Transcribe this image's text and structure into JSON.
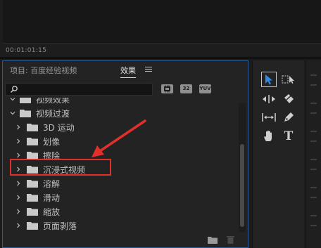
{
  "program_monitor": {
    "timecode": "00:01:01:15"
  },
  "project_panel": {
    "tab_project": "项目: 百度经验视频",
    "tab_effects": "效果",
    "search": {
      "value": "",
      "placeholder": ""
    },
    "filter_buttons": {
      "accelerated": "",
      "bit32": "32",
      "yuv": "YUV"
    },
    "tree": [
      {
        "label": "视频效果",
        "indent": 0,
        "expanded": true,
        "highlighted": false
      },
      {
        "label": "视频过渡",
        "indent": 0,
        "expanded": true,
        "highlighted": false
      },
      {
        "label": "3D 运动",
        "indent": 1,
        "expanded": false,
        "highlighted": false
      },
      {
        "label": "划像",
        "indent": 1,
        "expanded": false,
        "highlighted": false
      },
      {
        "label": "擦除",
        "indent": 1,
        "expanded": false,
        "highlighted": false
      },
      {
        "label": "沉浸式视频",
        "indent": 1,
        "expanded": false,
        "highlighted": true
      },
      {
        "label": "溶解",
        "indent": 1,
        "expanded": false,
        "highlighted": false
      },
      {
        "label": "滑动",
        "indent": 1,
        "expanded": false,
        "highlighted": false
      },
      {
        "label": "缩放",
        "indent": 1,
        "expanded": false,
        "highlighted": false
      },
      {
        "label": "页面剥落",
        "indent": 1,
        "expanded": false,
        "highlighted": false
      }
    ]
  },
  "tools": [
    {
      "name": "selection-tool-icon",
      "selected": true
    },
    {
      "name": "track-select-tool-icon",
      "selected": false
    },
    {
      "name": "ripple-edit-tool-icon",
      "selected": false
    },
    {
      "name": "razor-tool-icon",
      "selected": false
    },
    {
      "name": "slip-tool-icon",
      "selected": false
    },
    {
      "name": "pen-tool-icon",
      "selected": false
    },
    {
      "name": "hand-tool-icon",
      "selected": false
    },
    {
      "name": "type-tool-icon",
      "selected": false
    }
  ],
  "type_tool_glyph": "T",
  "colors": {
    "accent_blue": "#2b5c93",
    "highlight_red": "#e0302b",
    "selection_arrow": "#2d8ceb"
  }
}
